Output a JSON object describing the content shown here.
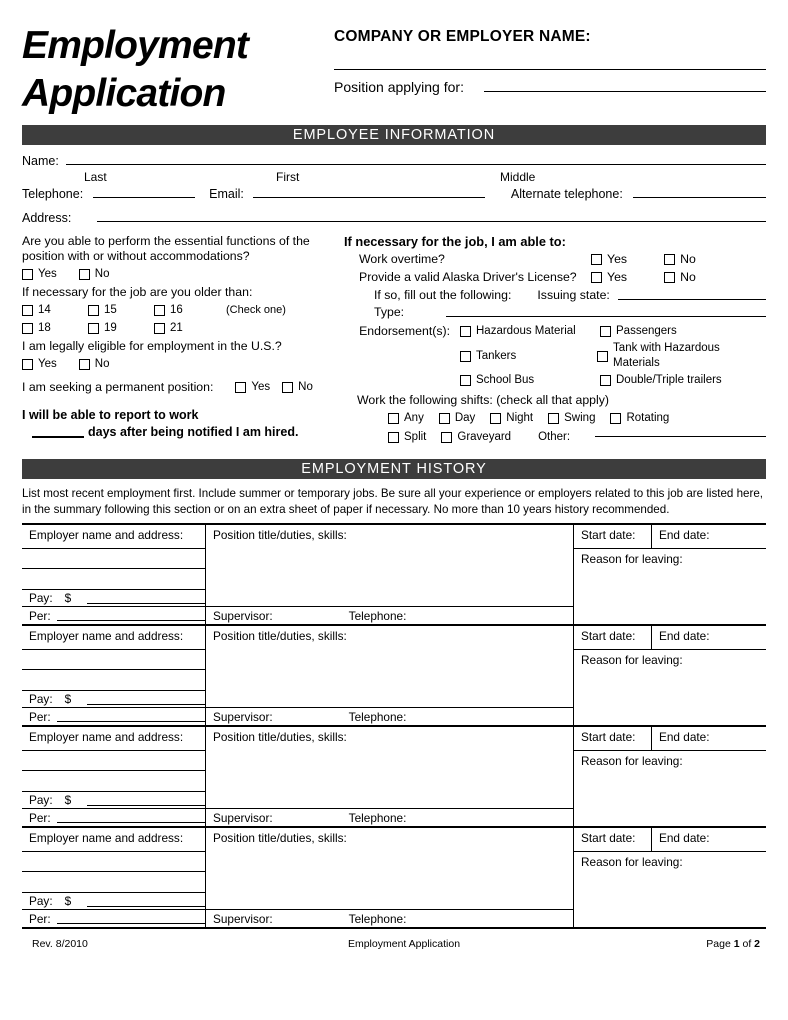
{
  "header": {
    "title_line1": "Employment",
    "title_line2": "Application",
    "company_label": "COMPANY OR EMPLOYER NAME:",
    "position_label": "Position applying for:"
  },
  "bands": {
    "employee_information": "EMPLOYEE INFORMATION",
    "employment_history": "EMPLOYMENT HISTORY"
  },
  "employee": {
    "name_label": "Name:",
    "last_label": "Last",
    "first_label": "First",
    "middle_label": "Middle",
    "telephone_label": "Telephone:",
    "email_label": "Email:",
    "alt_telephone_label": "Alternate telephone:",
    "address_label": "Address:"
  },
  "left_column": {
    "essential_functions_q": "Are you able to perform the essential functions of the position with or without accommodations?",
    "essential_yes": "Yes",
    "essential_no": "No",
    "age_q": "If necessary for the job are you older than:",
    "ages_row1": [
      "14",
      "15",
      "16"
    ],
    "check_one_hint": "(Check one)",
    "ages_row2": [
      "18",
      "19",
      "21"
    ],
    "eligible_q": "I am legally eligible for employment in the U.S.?",
    "eligible_yes": "Yes",
    "eligible_no": "No",
    "permanent_q": "I am seeking a permanent position:",
    "permanent_yes": "Yes",
    "permanent_no": "No",
    "report_line1": "I will be able to report to work",
    "report_line2": "days after being notified I am hired."
  },
  "right_column": {
    "heading": "If necessary for the job, I am able to:",
    "overtime_q": "Work overtime?",
    "overtime_yes": "Yes",
    "overtime_no": "No",
    "license_q": "Provide a valid Alaska Driver's License?",
    "license_yes": "Yes",
    "license_no": "No",
    "if_so_label": "If so, fill out the following:",
    "issuing_state_label": "Issuing state:",
    "type_label": "Type:",
    "endorsements_label": "Endorsement(s):",
    "endorsements": [
      [
        "Hazardous Material",
        "Passengers"
      ],
      [
        "Tankers",
        "Tank with Hazardous Materials"
      ],
      [
        "School Bus",
        "Double/Triple trailers"
      ]
    ],
    "shifts_label": "Work the following shifts: (check all that apply)",
    "shifts_row1": [
      "Any",
      "Day",
      "Night",
      "Swing",
      "Rotating"
    ],
    "shifts_row2": [
      "Split",
      "Graveyard"
    ],
    "other_label": "Other:"
  },
  "history": {
    "instructions": "List most recent employment first. Include summer or temporary jobs. Be sure all your experience or employers related to this job are listed here, in the summary following this section or on an extra sheet of paper if necessary. No more than 10 years history recommended.",
    "labels": {
      "employer": "Employer name and address:",
      "position": "Position title/duties, skills:",
      "start_date": "Start date:",
      "end_date": "End date:",
      "reason": "Reason for leaving:",
      "pay": "Pay:",
      "dollar": "$",
      "per": "Per:",
      "supervisor": "Supervisor:",
      "telephone": "Telephone:"
    },
    "row_count": 4
  },
  "footer": {
    "revision": "Rev. 8/2010",
    "doc_title": "Employment Application",
    "page_prefix": "Page ",
    "page_number": "1",
    "page_of": " of ",
    "page_total": "2"
  },
  "colors": {
    "band": "#3d3d3d",
    "rule": "#000000",
    "paper": "#ffffff"
  }
}
